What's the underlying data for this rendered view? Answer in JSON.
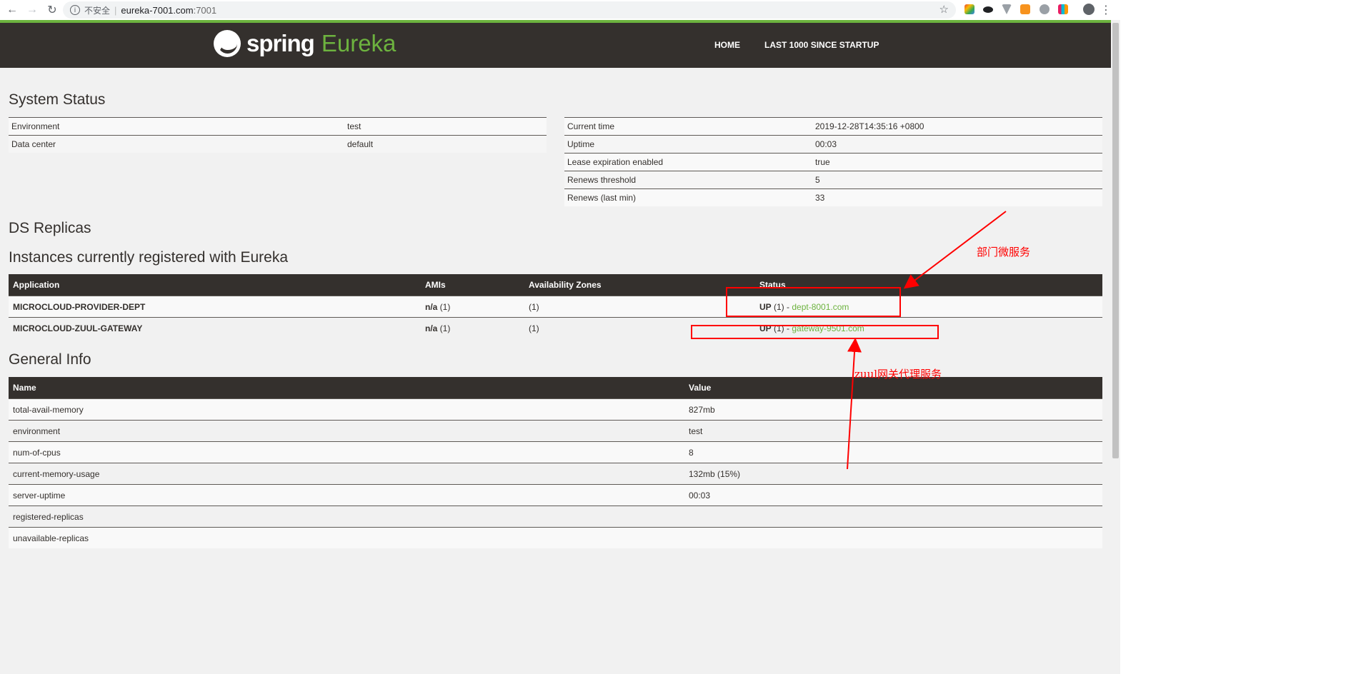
{
  "browser": {
    "insecure_label": "不安全",
    "url_host": "eureka-7001.com",
    "url_port": ":7001"
  },
  "header": {
    "logo_spring": "spring",
    "logo_eureka": "Eureka",
    "nav_home": "HOME",
    "nav_last": "LAST 1000 SINCE STARTUP"
  },
  "system_status": {
    "title": "System Status",
    "left": [
      {
        "key": "Environment",
        "value": "test"
      },
      {
        "key": "Data center",
        "value": "default"
      }
    ],
    "right": [
      {
        "key": "Current time",
        "value": "2019-12-28T14:35:16 +0800"
      },
      {
        "key": "Uptime",
        "value": "00:03"
      },
      {
        "key": "Lease expiration enabled",
        "value": "true"
      },
      {
        "key": "Renews threshold",
        "value": "5"
      },
      {
        "key": "Renews (last min)",
        "value": "33"
      }
    ]
  },
  "ds_replicas": {
    "title": "DS Replicas"
  },
  "instances": {
    "title": "Instances currently registered with Eureka",
    "headers": [
      "Application",
      "AMIs",
      "Availability Zones",
      "Status"
    ],
    "rows": [
      {
        "application": "MICROCLOUD-PROVIDER-DEPT",
        "amis_bold": "n/a",
        "amis_count": " (1)",
        "zones": "(1)",
        "status_bold": "UP",
        "status_count": " (1) - ",
        "status_link": "dept-8001.com"
      },
      {
        "application": "MICROCLOUD-ZUUL-GATEWAY",
        "amis_bold": "n/a",
        "amis_count": " (1)",
        "zones": "(1)",
        "status_bold": "UP",
        "status_count": " (1) - ",
        "status_link": "gateway-9501.com"
      }
    ]
  },
  "general_info": {
    "title": "General Info",
    "headers": [
      "Name",
      "Value"
    ],
    "rows": [
      {
        "name": "total-avail-memory",
        "value": "827mb"
      },
      {
        "name": "environment",
        "value": "test"
      },
      {
        "name": "num-of-cpus",
        "value": "8"
      },
      {
        "name": "current-memory-usage",
        "value": "132mb (15%)"
      },
      {
        "name": "server-uptime",
        "value": "00:03"
      },
      {
        "name": "registered-replicas",
        "value": ""
      },
      {
        "name": "unavailable-replicas",
        "value": ""
      }
    ]
  },
  "annotations": {
    "dept_label": "部门微服务",
    "zuul_label": "zuul网关代理服务"
  },
  "colors": {
    "brand_green": "#6db33f",
    "header_dark": "#34302d",
    "annotation_red": "#ff0000"
  }
}
